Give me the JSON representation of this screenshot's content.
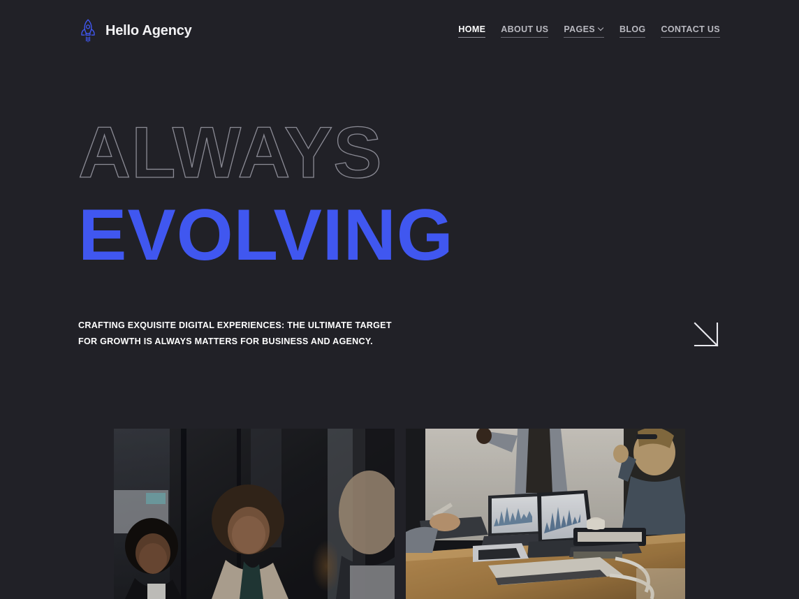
{
  "brand": {
    "name": "Hello Agency",
    "icon": "rocket-icon"
  },
  "nav": {
    "items": [
      {
        "label": "HOME",
        "active": true,
        "has_dropdown": false
      },
      {
        "label": "ABOUT US",
        "active": false,
        "has_dropdown": false
      },
      {
        "label": "PAGES",
        "active": false,
        "has_dropdown": true
      },
      {
        "label": "BLOG",
        "active": false,
        "has_dropdown": false
      },
      {
        "label": "CONTACT US",
        "active": false,
        "has_dropdown": false
      }
    ]
  },
  "hero": {
    "line_outline": "ALWAYS",
    "line_solid": "EVOLVING",
    "tagline": "CRAFTING EXQUISITE DIGITAL EXPERIENCES: THE ULTIMATE TARGET FOR GROWTH IS ALWAYS MATTERS FOR BUSINESS AND AGENCY.",
    "scroll_arrow_icon": "arrow-down-right-icon"
  },
  "showcase": {
    "items": [
      {
        "alt": "Two women smiling during an office meeting"
      },
      {
        "alt": "Team celebrating around a conference table with laptops showing charts"
      }
    ]
  },
  "colors": {
    "background": "#212127",
    "accent_blue": "#4057f0",
    "text_primary": "#ffffff",
    "text_muted": "#b9b9c0",
    "outline_stroke": "#8b8b95"
  }
}
